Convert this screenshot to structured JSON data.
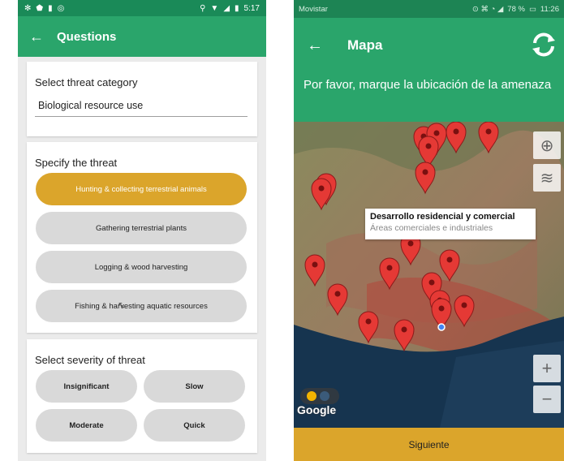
{
  "left": {
    "status": {
      "time": "5:17"
    },
    "appbar": {
      "title": "Questions"
    },
    "category": {
      "label": "Select threat category",
      "value": "Biological resource use"
    },
    "specify": {
      "label": "Specify the threat",
      "options": [
        "Hunting & collecting terrestrial animals",
        "Gathering terrestrial plants",
        "Logging & wood harvesting",
        "Fishing & harvesting aquatic resources"
      ],
      "selected_index": 0
    },
    "severity": {
      "label": "Select severity of threat",
      "options": [
        "Insignificant",
        "Slow",
        "Moderate",
        "Quick"
      ]
    },
    "colors": {
      "primary": "#2aa56b",
      "accent": "#dba52b",
      "pill": "#d9d9d9"
    }
  },
  "right": {
    "status": {
      "carrier": "Movistar",
      "battery": "78 %",
      "time": "11:26"
    },
    "appbar": {
      "title": "Mapa"
    },
    "instruction": "Por favor, marque la ubicación de la amenaza",
    "tooltip": {
      "title": "Desarrollo residencial y comercial",
      "subtitle": "Áreas comerciales e industriales"
    },
    "zoom": {
      "in": "+",
      "out": "−"
    },
    "google": "Google",
    "next_button": "Siguiente",
    "marker_color": "#e53935"
  }
}
